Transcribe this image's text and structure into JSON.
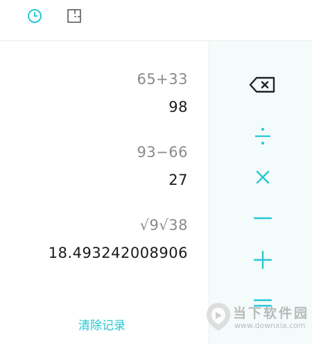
{
  "toolbar": {
    "history_icon": "clock-icon",
    "converter_icon": "unit-converter-icon",
    "accent_color": "#27c7d2"
  },
  "history": {
    "entries": [
      {
        "expression": "65+33",
        "result": "98"
      },
      {
        "expression": "93−66",
        "result": "27"
      },
      {
        "expression": "√9√38",
        "result": "18.493242008906"
      }
    ],
    "clear_label": "清除记录"
  },
  "operators": {
    "backspace": "backspace-icon",
    "divide": "÷",
    "multiply": "×",
    "subtract": "−",
    "add": "+",
    "equals": "="
  },
  "watermark": {
    "brand": "当下软件园",
    "url": "www.downxia.com"
  }
}
